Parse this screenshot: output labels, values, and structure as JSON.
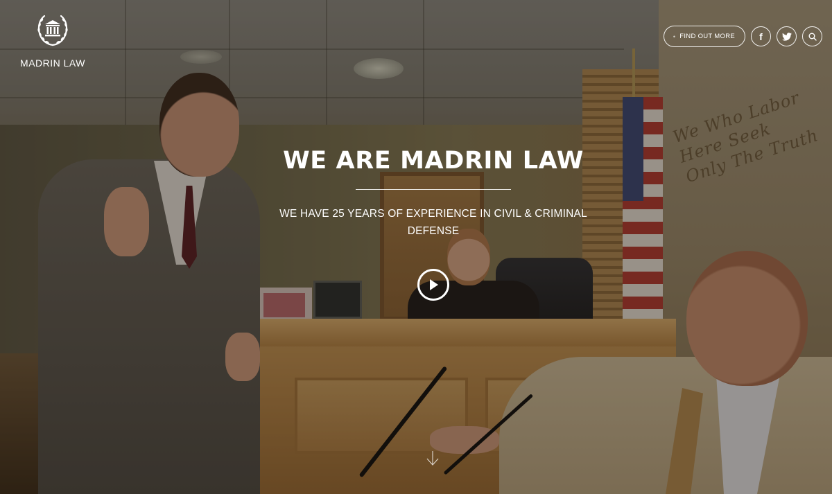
{
  "brand": {
    "name": "MADRIN LAW",
    "emblem_icon": "courthouse-laurel-icon"
  },
  "header": {
    "find_out_more_label": "FIND OUT MORE",
    "find_out_more_icon": "dot-icon",
    "social": [
      {
        "name": "facebook",
        "icon": "facebook-icon",
        "glyph": "f"
      },
      {
        "name": "twitter",
        "icon": "twitter-icon"
      }
    ],
    "search_icon": "search-icon"
  },
  "hero": {
    "title": "WE ARE MADRIN LAW",
    "subtitle": "WE HAVE 25 YEARS OF EXPERIENCE IN CIVIL & CRIMINAL DEFENSE",
    "play_icon": "play-icon",
    "scroll_icon": "arrow-down-icon",
    "wall_motto": "We Who Labor Here Seek Only The Truth"
  },
  "colors": {
    "text": "#ffffff",
    "overlay": "#140e06",
    "wood": "#b7874a"
  }
}
